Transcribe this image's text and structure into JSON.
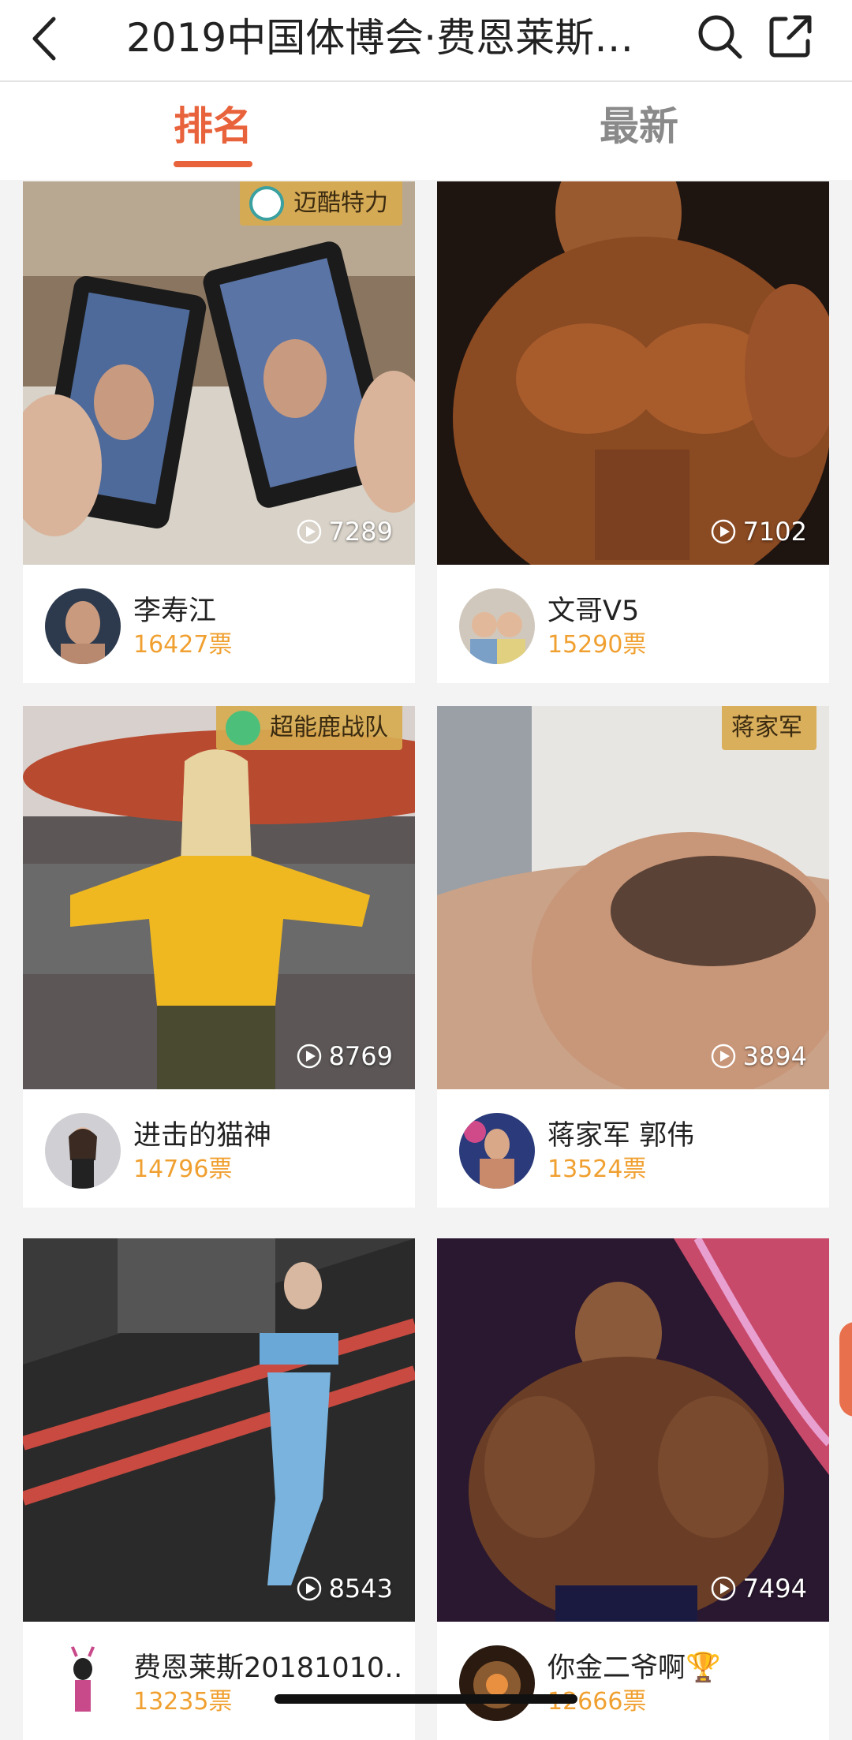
{
  "header": {
    "title": "2019中国体博会·费恩莱斯…",
    "back_icon": "chevron-left-icon",
    "search_icon": "search-icon",
    "share_icon": "share-icon"
  },
  "tabs": [
    {
      "label": "排名",
      "active": true
    },
    {
      "label": "最新",
      "active": false
    }
  ],
  "colors": {
    "accent": "#e8623b",
    "votes": "#f0a030",
    "badge": "#d7aa50"
  },
  "entries": [
    {
      "name": "李寿江",
      "votes": "16427票",
      "plays": "7289",
      "team": "迈酷特力"
    },
    {
      "name": "文哥V5",
      "votes": "15290票",
      "plays": "7102",
      "team": ""
    },
    {
      "name": "进击的猫神",
      "votes": "14796票",
      "plays": "8769",
      "team": "超能鹿战队"
    },
    {
      "name": "蒋家军 郭伟",
      "votes": "13524票",
      "plays": "3894",
      "team": "蒋家军"
    },
    {
      "name": "费恩莱斯20181010…",
      "votes": "13235票",
      "plays": "8543",
      "team": ""
    },
    {
      "name": "你金二爷啊",
      "votes": "12666票",
      "plays": "7494",
      "team": ""
    }
  ]
}
